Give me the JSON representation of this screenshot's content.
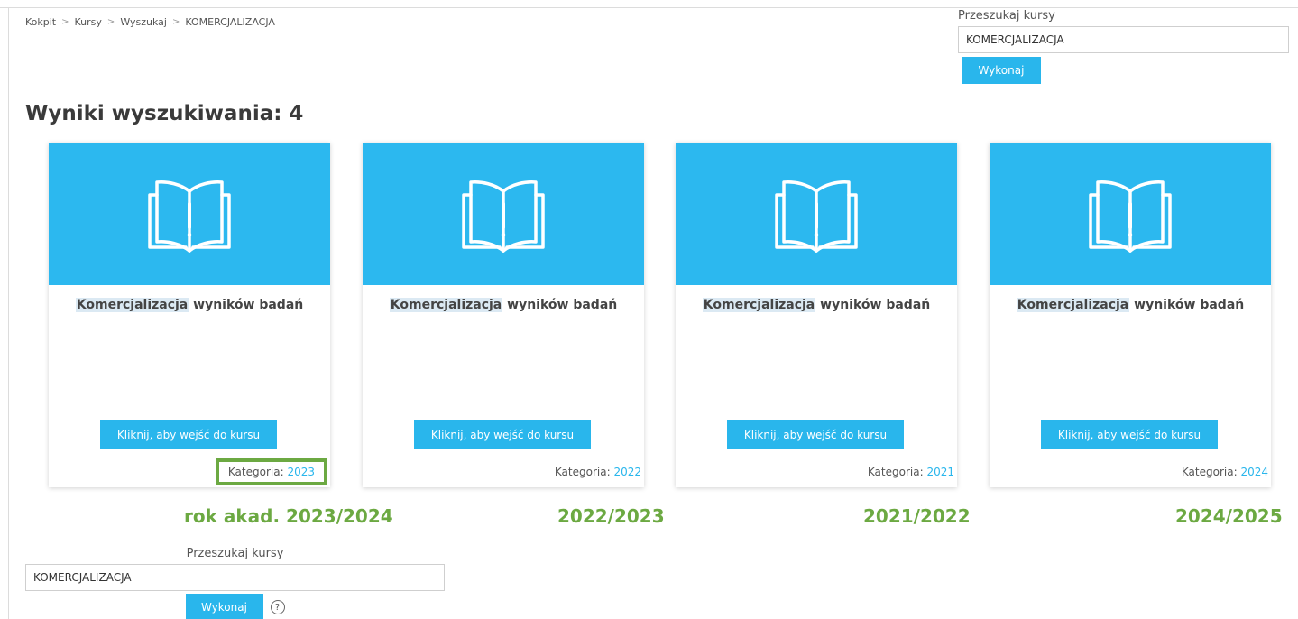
{
  "breadcrumb": [
    "Kokpit",
    "Kursy",
    "Wyszukaj",
    "KOMERCJALIZACJA"
  ],
  "search": {
    "label": "Przeszukaj kursy",
    "value": "KOMERCJALIZACJA",
    "button": "Wykonaj"
  },
  "results_title": "Wyniki wyszukiwania: 4",
  "cards": [
    {
      "title_highlight": "Komercjalizacja",
      "title_rest": " wyników badań",
      "button": "Kliknij, aby wejść do kursu",
      "category_label": "Kategoria:",
      "category_value": "2023"
    },
    {
      "title_highlight": "Komercjalizacja",
      "title_rest": " wyników badań",
      "button": "Kliknij, aby wejść do kursu",
      "category_label": "Kategoria:",
      "category_value": "2022"
    },
    {
      "title_highlight": "Komercjalizacja",
      "title_rest": " wyników badań",
      "button": "Kliknij, aby wejść do kursu",
      "category_label": "Kategoria:",
      "category_value": "2021"
    },
    {
      "title_highlight": "Komercjalizacja",
      "title_rest": " wyników badań",
      "button": "Kliknij, aby wejść do kursu",
      "category_label": "Kategoria:",
      "category_value": "2024"
    }
  ],
  "year_labels": [
    "rok akad. 2023/2024",
    "2022/2023",
    "2021/2022",
    "2024/2025"
  ],
  "icons": {
    "course": "open-book-icon",
    "help": "help-icon"
  },
  "colors": {
    "accent": "#29b6ec",
    "card_image": "#2cb8ef",
    "annotation": "#6ca942"
  }
}
